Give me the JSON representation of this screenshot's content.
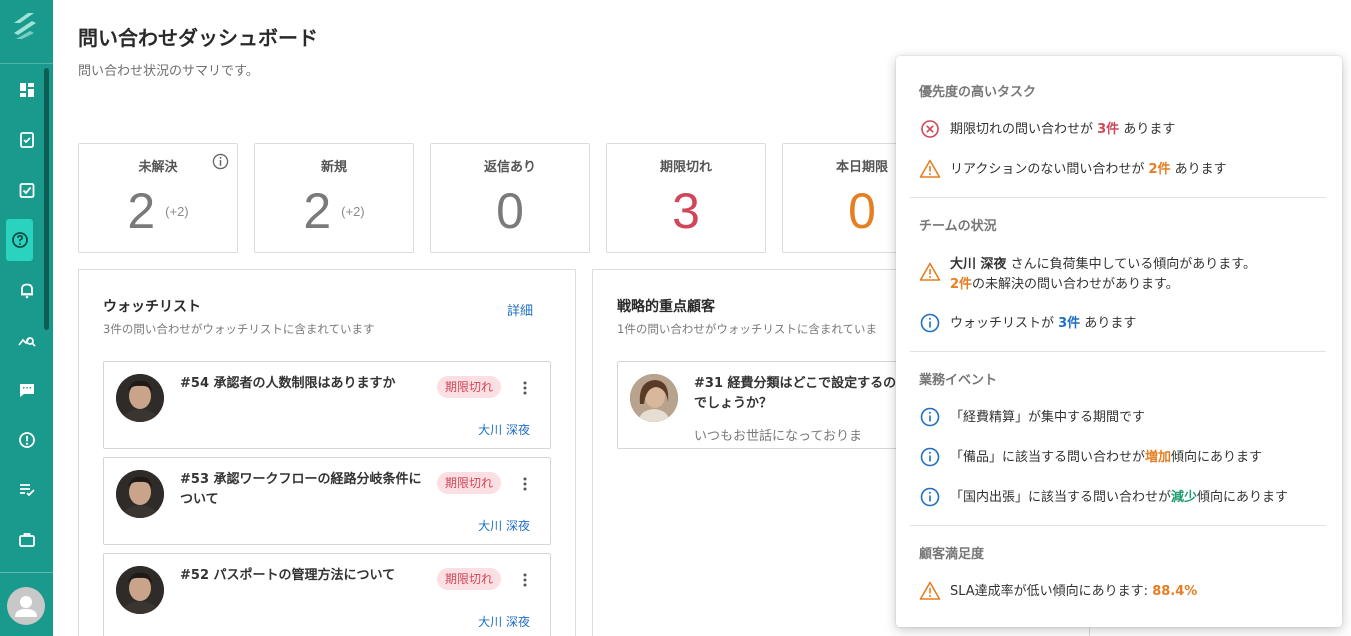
{
  "header": {
    "title": "問い合わせダッシュボード",
    "subtitle": "問い合わせ状況のサマリです。"
  },
  "sidebar": {
    "items": [
      {
        "icon": "dashboard-icon"
      },
      {
        "icon": "clipboard-check-icon"
      },
      {
        "icon": "checkbox-icon"
      },
      {
        "icon": "help-circle-icon",
        "active": true
      },
      {
        "icon": "bell-icon"
      },
      {
        "icon": "chart-search-icon"
      },
      {
        "icon": "chat-icon"
      },
      {
        "icon": "alert-circle-icon"
      },
      {
        "icon": "checklist-icon"
      },
      {
        "icon": "briefcase-icon"
      }
    ],
    "user_icon": "user-avatar-icon"
  },
  "stats": [
    {
      "label": "未解決",
      "value": "2",
      "delta": "(+2)",
      "color": "#7a7a7a",
      "info": true
    },
    {
      "label": "新規",
      "value": "2",
      "delta": "(+2)",
      "color": "#7a7a7a"
    },
    {
      "label": "返信あり",
      "value": "0",
      "delta": "",
      "color": "#7a7a7a"
    },
    {
      "label": "期限切れ",
      "value": "3",
      "delta": "",
      "color": "#d1475a"
    },
    {
      "label": "本日期限",
      "value": "0",
      "delta": "",
      "color": "#e67e22"
    }
  ],
  "watchlist": {
    "title": "ウォッチリスト",
    "subtitle": "3件の問い合わせがウォッチリストに含まれています",
    "link": "詳細",
    "tickets": [
      {
        "title": "#54 承認者の人数制限はありますか",
        "badge": "期限切れ",
        "assignee": "大川 深夜"
      },
      {
        "title": "#53 承認ワークフローの経路分岐条件について",
        "badge": "期限切れ",
        "assignee": "大川 深夜"
      },
      {
        "title": "#52 パスポートの管理方法について",
        "badge": "期限切れ",
        "assignee": "大川 深夜"
      }
    ]
  },
  "strategic": {
    "title": "戦略的重点顧客",
    "subtitle": "1件の問い合わせがウォッチリストに含まれていま",
    "ticket": {
      "title": "#31 経費分類はどこで設定するのでしょうか？",
      "body": "いつもお世話になっておりま"
    }
  },
  "popover": {
    "priority": {
      "heading": "優先度の高いタスク",
      "rows": [
        {
          "icon": "error-circle-icon",
          "pre": "期限切れの問い合わせが ",
          "hl": "3件",
          "post": " あります"
        },
        {
          "icon": "warning-triangle-icon",
          "pre": "リアクションのない問い合わせが ",
          "hl": "2件",
          "post": " あります"
        }
      ]
    },
    "team": {
      "heading": "チームの状況",
      "rows": [
        {
          "icon": "warning-triangle-icon",
          "name": "大川 深夜",
          "line1": " さんに負荷集中している傾向があります。",
          "hl": "2件",
          "line2": "の未解決の問い合わせがあります。"
        },
        {
          "icon": "info-circle-icon",
          "pre": "ウォッチリストが ",
          "hl": "3件",
          "post": " あります"
        }
      ]
    },
    "events": {
      "heading": "業務イベント",
      "rows": [
        {
          "icon": "info-circle-icon",
          "pre": "「経費精算」が集中する期間です",
          "hl": "",
          "post": ""
        },
        {
          "icon": "info-circle-icon",
          "pre": "「備品」に該当する問い合わせが",
          "hl": "増加",
          "post": "傾向にあります"
        },
        {
          "icon": "info-circle-icon",
          "pre": "「国内出張」に該当する問い合わせが",
          "hl": "減少",
          "post": "傾向にあります"
        }
      ]
    },
    "satisfaction": {
      "heading": "顧客満足度",
      "rows": [
        {
          "icon": "warning-triangle-icon",
          "pre": "SLA達成率が低い傾向にあります: ",
          "hl": "88.4%",
          "post": ""
        }
      ]
    }
  },
  "colors": {
    "sidebar": "#1a9a8c",
    "accent": "#2ad3be",
    "danger": "#d1475a",
    "warning": "#e67e22",
    "link": "#1f6fc4",
    "success": "#1f9e6e"
  }
}
